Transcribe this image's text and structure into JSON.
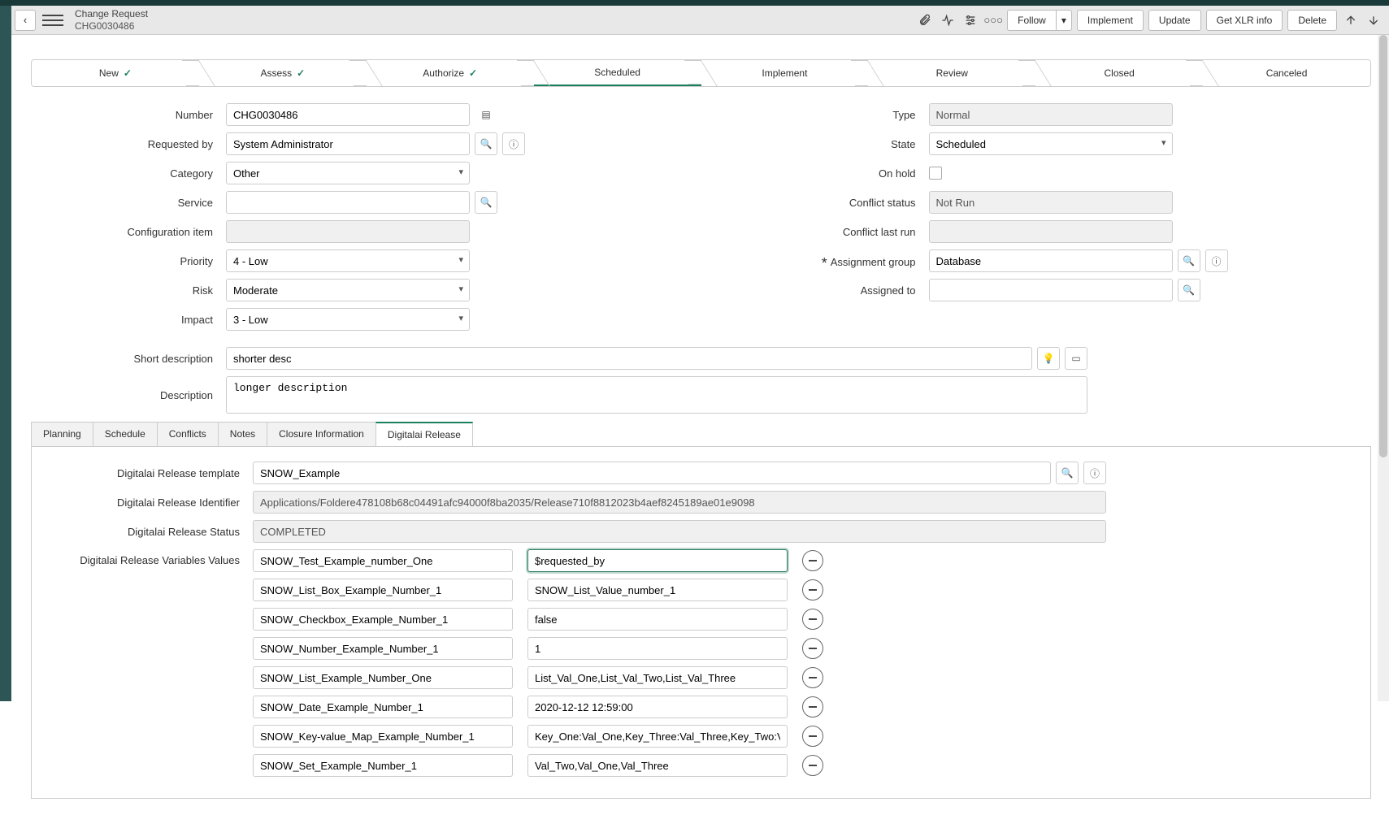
{
  "header": {
    "title": "Change Request",
    "subtitle": "CHG0030486",
    "buttons": {
      "follow": "Follow",
      "implement": "Implement",
      "update": "Update",
      "getxlr": "Get XLR info",
      "delete": "Delete"
    }
  },
  "stages": {
    "new": "New",
    "assess": "Assess",
    "authorize": "Authorize",
    "scheduled": "Scheduled",
    "implement": "Implement",
    "review": "Review",
    "closed": "Closed",
    "canceled": "Canceled"
  },
  "form": {
    "left": {
      "number_label": "Number",
      "number": "CHG0030486",
      "requested_by_label": "Requested by",
      "requested_by": "System Administrator",
      "category_label": "Category",
      "category": "Other",
      "service_label": "Service",
      "service": "",
      "config_item_label": "Configuration item",
      "config_item": "",
      "priority_label": "Priority",
      "priority": "4 - Low",
      "risk_label": "Risk",
      "risk": "Moderate",
      "impact_label": "Impact",
      "impact": "3 - Low"
    },
    "right": {
      "type_label": "Type",
      "type": "Normal",
      "state_label": "State",
      "state": "Scheduled",
      "on_hold_label": "On hold",
      "conflict_status_label": "Conflict status",
      "conflict_status": "Not Run",
      "conflict_last_run_label": "Conflict last run",
      "conflict_last_run": "",
      "assignment_group_label": "Assignment group",
      "assignment_group": "Database",
      "assigned_to_label": "Assigned to",
      "assigned_to": ""
    },
    "short_desc_label": "Short description",
    "short_desc": "shorter desc",
    "desc_label": "Description",
    "desc": "longer description"
  },
  "tabs": {
    "planning": "Planning",
    "schedule": "Schedule",
    "conflicts": "Conflicts",
    "notes": "Notes",
    "closure": "Closure Information",
    "digitalai": "Digitalai Release"
  },
  "release": {
    "template_label": "Digitalai Release template",
    "template": "SNOW_Example",
    "identifier_label": "Digitalai Release Identifier",
    "identifier": "Applications/Foldere478108b68c04491afc94000f8ba2035/Release710f8812023b4aef8245189ae01e9098",
    "status_label": "Digitalai Release Status",
    "status": "COMPLETED",
    "vars_label": "Digitalai Release Variables Values",
    "vars": [
      {
        "key": "SNOW_Test_Example_number_One",
        "val": "$requested_by",
        "focused": true
      },
      {
        "key": "SNOW_List_Box_Example_Number_1",
        "val": "SNOW_List_Value_number_1"
      },
      {
        "key": "SNOW_Checkbox_Example_Number_1",
        "val": "false"
      },
      {
        "key": "SNOW_Number_Example_Number_1",
        "val": "1"
      },
      {
        "key": "SNOW_List_Example_Number_One",
        "val": "List_Val_One,List_Val_Two,List_Val_Three"
      },
      {
        "key": "SNOW_Date_Example_Number_1",
        "val": "2020-12-12 12:59:00"
      },
      {
        "key": "SNOW_Key-value_Map_Example_Number_1",
        "val": "Key_One:Val_One,Key_Three:Val_Three,Key_Two:Val_Two"
      },
      {
        "key": "SNOW_Set_Example_Number_1",
        "val": "Val_Two,Val_One,Val_Three"
      }
    ]
  }
}
